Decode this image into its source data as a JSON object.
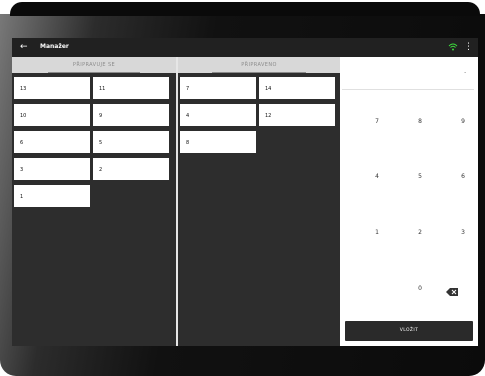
{
  "appbar": {
    "title": "Manažer",
    "icons": {
      "back": "arrow-back-icon",
      "wifi": "wifi-icon",
      "more": "more-vert-icon"
    },
    "wifi_color": "#3ddc3d"
  },
  "columns": {
    "preparing": {
      "tab_label": "PŘIPRAVUJE SE",
      "orders": [
        "13",
        "11",
        "10",
        "9",
        "6",
        "5",
        "3",
        "2",
        "1"
      ]
    },
    "prepared": {
      "tab_label": "PŘIPRAVENO",
      "orders": [
        "7",
        "14",
        "4",
        "12",
        "8"
      ]
    }
  },
  "keypad": {
    "display_value": "",
    "caret": "-",
    "keys": [
      "7",
      "8",
      "9",
      "4",
      "5",
      "6",
      "1",
      "2",
      "3",
      "0"
    ],
    "backspace_icon": "backspace-icon",
    "submit_label": "VLOŽIT"
  },
  "colors": {
    "appbar": "#212121",
    "panel": "#2d2d2d",
    "tab": "#d8d8d8",
    "submit": "#2a2a2a"
  }
}
